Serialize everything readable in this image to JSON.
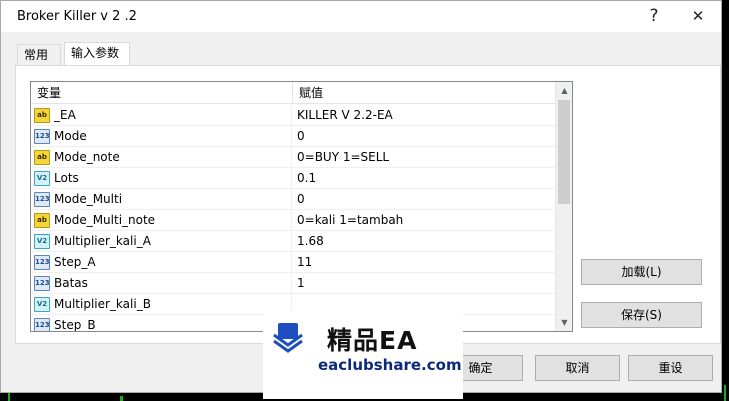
{
  "window": {
    "title": "Broker Killer v 2 .2",
    "help_glyph": "?",
    "close_glyph": "✕"
  },
  "tabs": [
    {
      "label": "常用",
      "active": false
    },
    {
      "label": "输入参数",
      "active": true
    }
  ],
  "grid": {
    "columns": [
      "变量",
      "赋值"
    ],
    "rows": [
      {
        "type": "ab",
        "icon": "string-type-icon",
        "name": "_EA",
        "value": "KILLER V 2.2-EA"
      },
      {
        "type": "123",
        "icon": "integer-type-icon",
        "name": "Mode",
        "value": "0"
      },
      {
        "type": "ab",
        "icon": "string-type-icon",
        "name": "Mode_note",
        "value": "0=BUY 1=SELL"
      },
      {
        "type": "V2",
        "icon": "double-type-icon",
        "name": "Lots",
        "value": "0.1"
      },
      {
        "type": "123",
        "icon": "integer-type-icon",
        "name": "Mode_Multi",
        "value": "0"
      },
      {
        "type": "ab",
        "icon": "string-type-icon",
        "name": "Mode_Multi_note",
        "value": "0=kali 1=tambah"
      },
      {
        "type": "V2",
        "icon": "double-type-icon",
        "name": "Multiplier_kali_A",
        "value": "1.68"
      },
      {
        "type": "123",
        "icon": "integer-type-icon",
        "name": "Step_A",
        "value": "11"
      },
      {
        "type": "123",
        "icon": "integer-type-icon",
        "name": "Batas",
        "value": "1"
      },
      {
        "type": "V2",
        "icon": "double-type-icon",
        "name": "Multiplier_kali_B",
        "value": ""
      },
      {
        "type": "123",
        "icon": "integer-type-icon",
        "name": "Step_B",
        "value": ""
      }
    ]
  },
  "side_buttons": {
    "load": "加载(L)",
    "save": "保存(S)"
  },
  "footer_buttons": {
    "ok": "确定",
    "cancel": "取消",
    "reset": "重设"
  },
  "watermark": {
    "title": "精品EA",
    "url": "eaclubshare.com"
  },
  "colors": {
    "dialog_bg": "#f0f0f0",
    "string_icon": "#f4d63a",
    "int_icon": "#dfe9f5",
    "double_icon": "#d4f1f7",
    "watermark_blue": "#1f4fbf"
  }
}
